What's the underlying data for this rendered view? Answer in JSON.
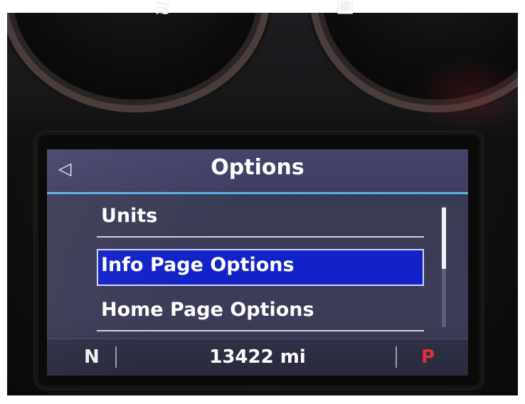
{
  "gauges": {
    "left_icon": "coolant-temp-icon",
    "left_glyph": "≋",
    "right_icon": "fuel-pump-icon",
    "right_glyph": "▣"
  },
  "screen": {
    "title": "Options",
    "back_glyph": "◁",
    "menu": [
      {
        "label": "Units",
        "selected": false
      },
      {
        "label": "Info Page Options",
        "selected": true
      },
      {
        "label": "Home Page Options",
        "selected": false
      }
    ],
    "status": {
      "gear_left": "N",
      "odometer": "13422 mi",
      "gear_right": "P"
    }
  },
  "colors": {
    "selection": "#1322c6",
    "accent_line": "#55b5e0",
    "park_red": "#e0323a"
  }
}
